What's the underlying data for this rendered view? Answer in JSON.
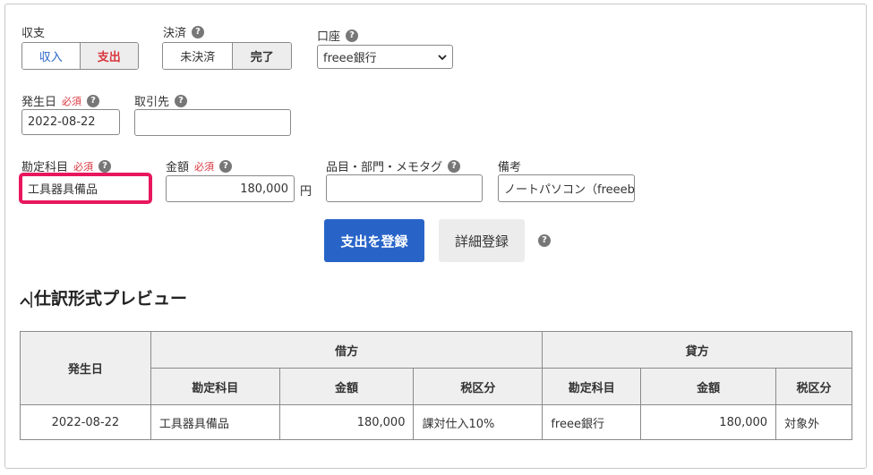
{
  "form": {
    "shushi": {
      "label": "収支",
      "options": [
        "収入",
        "支出"
      ],
      "selected": "支出"
    },
    "kessai": {
      "label": "決済",
      "options": [
        "未決済",
        "完了"
      ],
      "selected": "完了"
    },
    "account": {
      "label": "口座",
      "value": "freee銀行"
    },
    "date": {
      "label": "発生日",
      "required": "必須",
      "value": "2022-08-22"
    },
    "partner": {
      "label": "取引先",
      "value": ""
    },
    "category": {
      "label": "勘定科目",
      "required": "必須",
      "value": "工具器具備品"
    },
    "amount": {
      "label": "金額",
      "required": "必須",
      "value": "180,000",
      "unit": "円"
    },
    "tags": {
      "label": "品目・部門・メモタグ",
      "value": ""
    },
    "memo": {
      "label": "備考",
      "value": "ノートパソコン（freeeb"
    },
    "help_glyph": "?"
  },
  "actions": {
    "register": "支出を登録",
    "detail": "詳細登録"
  },
  "preview": {
    "title": "仕訳形式プレビュー",
    "date_header": "発生日",
    "debit_header": "借方",
    "credit_header": "貸方",
    "sub_headers": [
      "勘定科目",
      "金額",
      "税区分"
    ],
    "row": {
      "date": "2022-08-22",
      "debit_account": "工具器具備品",
      "debit_amount": "180,000",
      "debit_tax": "課対仕入10%",
      "credit_account": "freee銀行",
      "credit_amount": "180,000",
      "credit_tax": "対象外"
    }
  },
  "colors": {
    "primary": "#2864c8",
    "highlight": "#e8175d",
    "required": "#d9363e",
    "income_text": "#2864c8",
    "expense_text": "#d9363e"
  },
  "icons": {
    "help": "question-circle-icon",
    "chevron": "chevron-down-icon",
    "collapse": "chevron-up-icon"
  }
}
